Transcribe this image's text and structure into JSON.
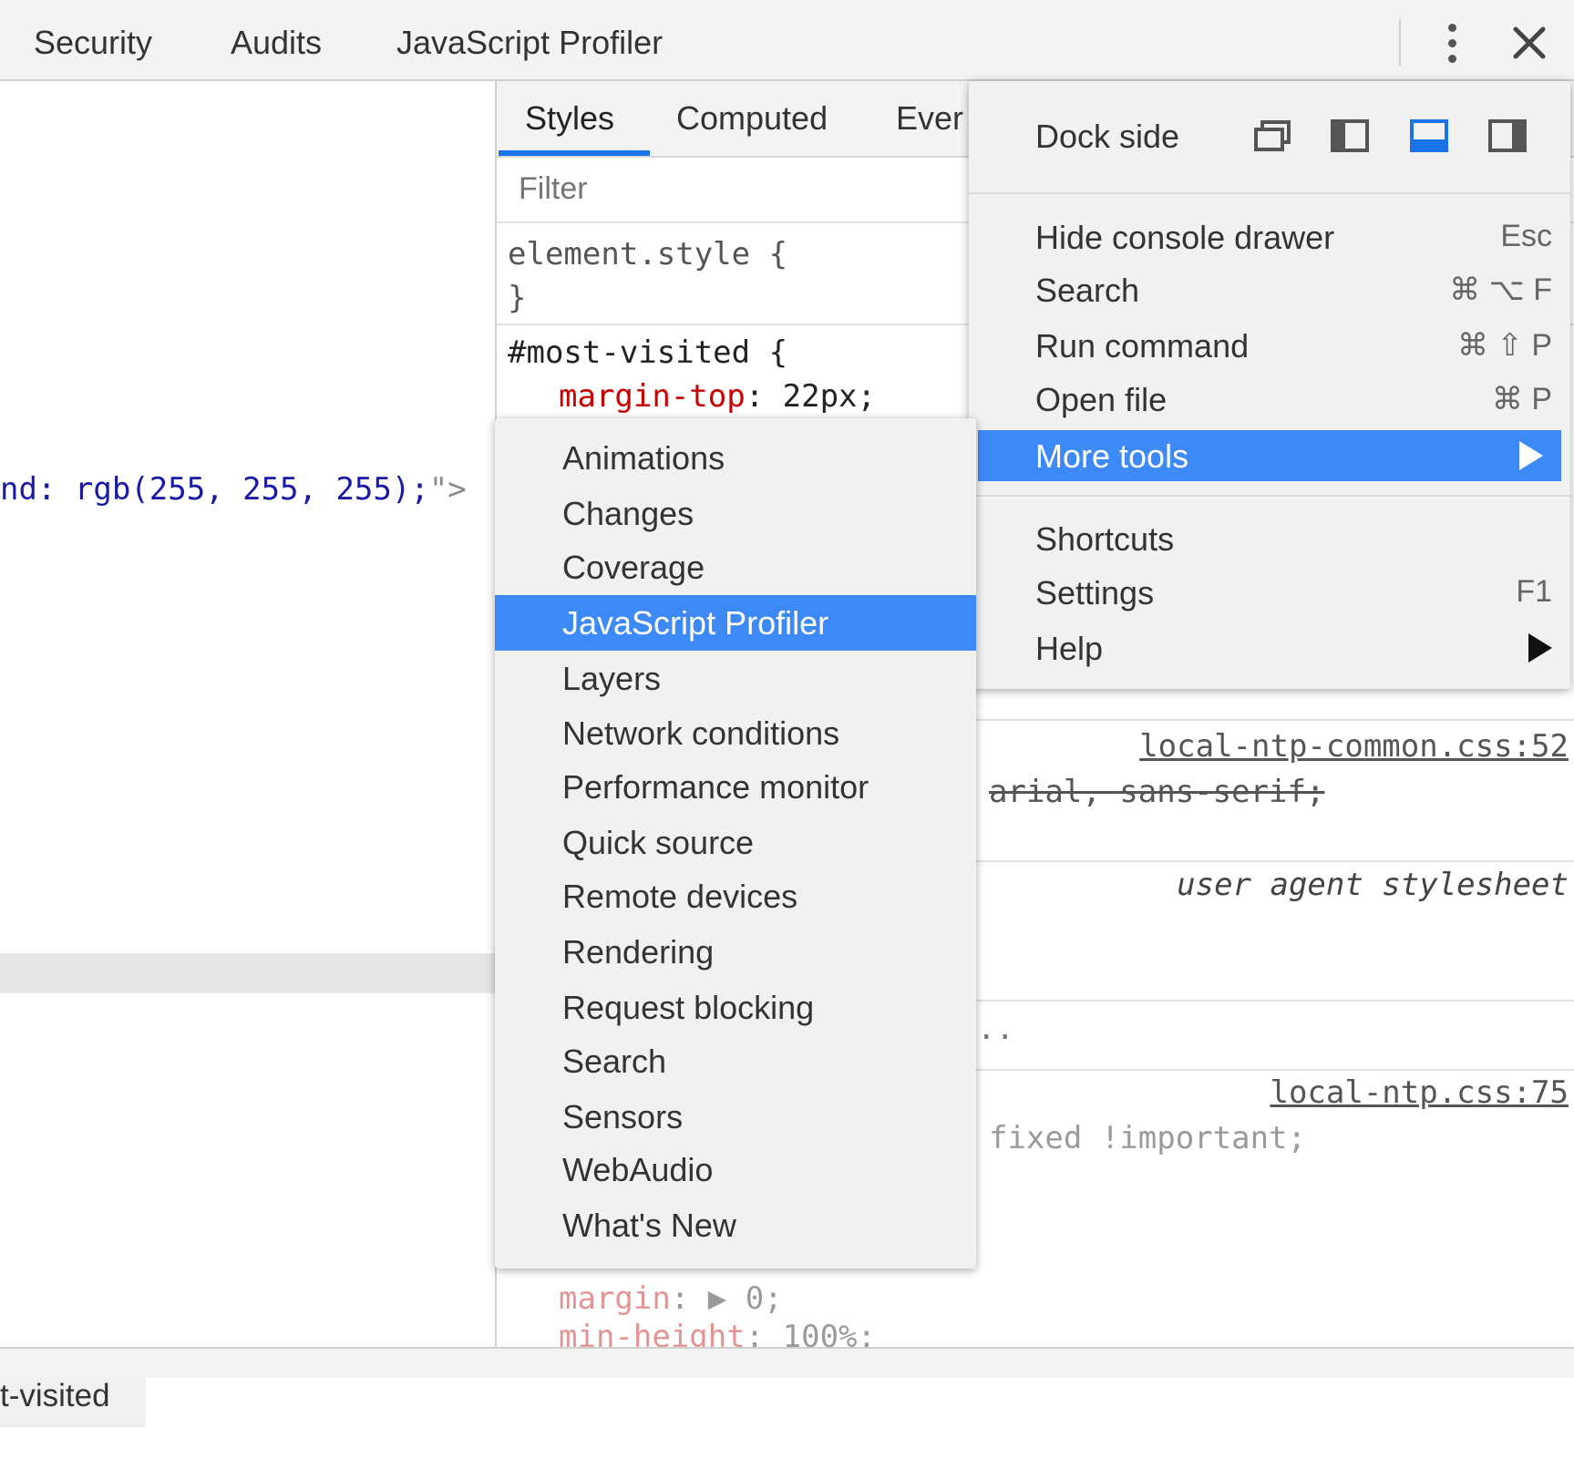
{
  "toolbar": {
    "tabs": [
      "Security",
      "Audits",
      "JavaScript Profiler"
    ],
    "more_icon": "kebab-vertical-icon",
    "close_icon": "close-icon"
  },
  "elements": {
    "code_attr_tail": "nd: rgb(255, 255, 255);",
    "code_quote_close": "\">",
    "breadcrumb": "t-visited"
  },
  "styles": {
    "tabs": [
      "Styles",
      "Computed",
      "Ever"
    ],
    "filter_placeholder": "Filter",
    "element_style_open": "element.style {",
    "element_style_close": "}",
    "rule1_selector": "#most-visited {",
    "rule1_prop": "margin-top",
    "rule1_value": ": 22px;",
    "source1": "local-ntp-common.css:52",
    "font_struck": "arial, sans-serif;",
    "ua_label": "user agent stylesheet",
    "ellipsis": "..",
    "source2": "local-ntp.css:75",
    "fixed_text": "fixed !important;",
    "margin_prop": "margin",
    "margin_value": ": ▶ 0;",
    "minheight_prop": "min-height",
    "minheight_value": ": 100%;"
  },
  "main_menu": {
    "dock_side_label": "Dock side",
    "dock_icons": [
      "undock-icon",
      "dock-left-icon",
      "dock-bottom-icon",
      "dock-right-icon"
    ],
    "active_dock": "dock-bottom-icon",
    "items": [
      {
        "label": "Hide console drawer",
        "shortcut": "Esc"
      },
      {
        "label": "Search",
        "shortcut": "⌘ ⌥ F"
      },
      {
        "label": "Run command",
        "shortcut": "⌘ ⇧ P"
      },
      {
        "label": "Open file",
        "shortcut": "⌘ P"
      },
      {
        "label": "More tools",
        "shortcut": ""
      },
      {
        "label": "Shortcuts",
        "shortcut": ""
      },
      {
        "label": "Settings",
        "shortcut": "F1"
      },
      {
        "label": "Help",
        "shortcut": ""
      }
    ],
    "active_item": "More tools",
    "accent": "#3d8af7"
  },
  "more_tools_submenu": {
    "items": [
      "Animations",
      "Changes",
      "Coverage",
      "JavaScript Profiler",
      "Layers",
      "Network conditions",
      "Performance monitor",
      "Quick source",
      "Remote devices",
      "Rendering",
      "Request blocking",
      "Search",
      "Sensors",
      "WebAudio",
      "What's New"
    ],
    "active_item": "JavaScript Profiler"
  }
}
